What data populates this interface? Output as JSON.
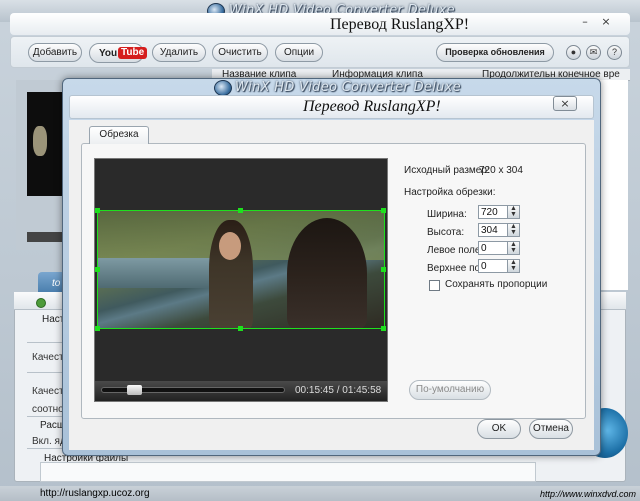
{
  "app": {
    "title": "WinX HD Video Converter Deluxe",
    "banner": "Перевод RuslangXP!"
  },
  "toolbar": {
    "add": "Добавить",
    "youtube_you": "You",
    "youtube_tube": "Tube",
    "remove": "Удалить",
    "clear": "Очистить",
    "options": "Опции",
    "check_updates": "Проверка обновления"
  },
  "columns": {
    "clip_name": "Название клипа",
    "clip_info": "Информация клипа",
    "duration": "Продолжительн",
    "final": "конечное вре"
  },
  "side_tab": "to",
  "settings": {
    "s1": "Наст",
    "s1_line": "Качеств",
    "s2_line_a": "Качеств",
    "s2_line_b": "соотнош",
    "s3": "Расш",
    "s3_line": "Вкл. ядр",
    "s4": "Настройки файлы"
  },
  "footer": {
    "url_left": "http://ruslangxp.ucoz.org",
    "url_right": "http://www.winxdvd.com"
  },
  "dialog": {
    "title": "WinX HD Video Converter Deluxe",
    "banner": "Перевод RuslangXP!",
    "close": "×",
    "tab": "Обрезка",
    "source_size_label": "Исходный размер:",
    "source_size_value": "720 x 304",
    "crop_settings_label": "Настройка обрезки:",
    "width_label": "Ширина:",
    "width_value": "720",
    "height_label": "Высота:",
    "height_value": "304",
    "left_label": "Левое поле:",
    "left_value": "0",
    "top_label": "Верхнее поле:",
    "top_value": "0",
    "keep_ratio": "Сохранять пропорции",
    "default_btn": "По-умолчанию",
    "ok_btn": "OK",
    "cancel_btn": "Отмена",
    "time_current": "00:15:45",
    "time_total": "01:45:58",
    "seek_fraction": 0.15
  }
}
